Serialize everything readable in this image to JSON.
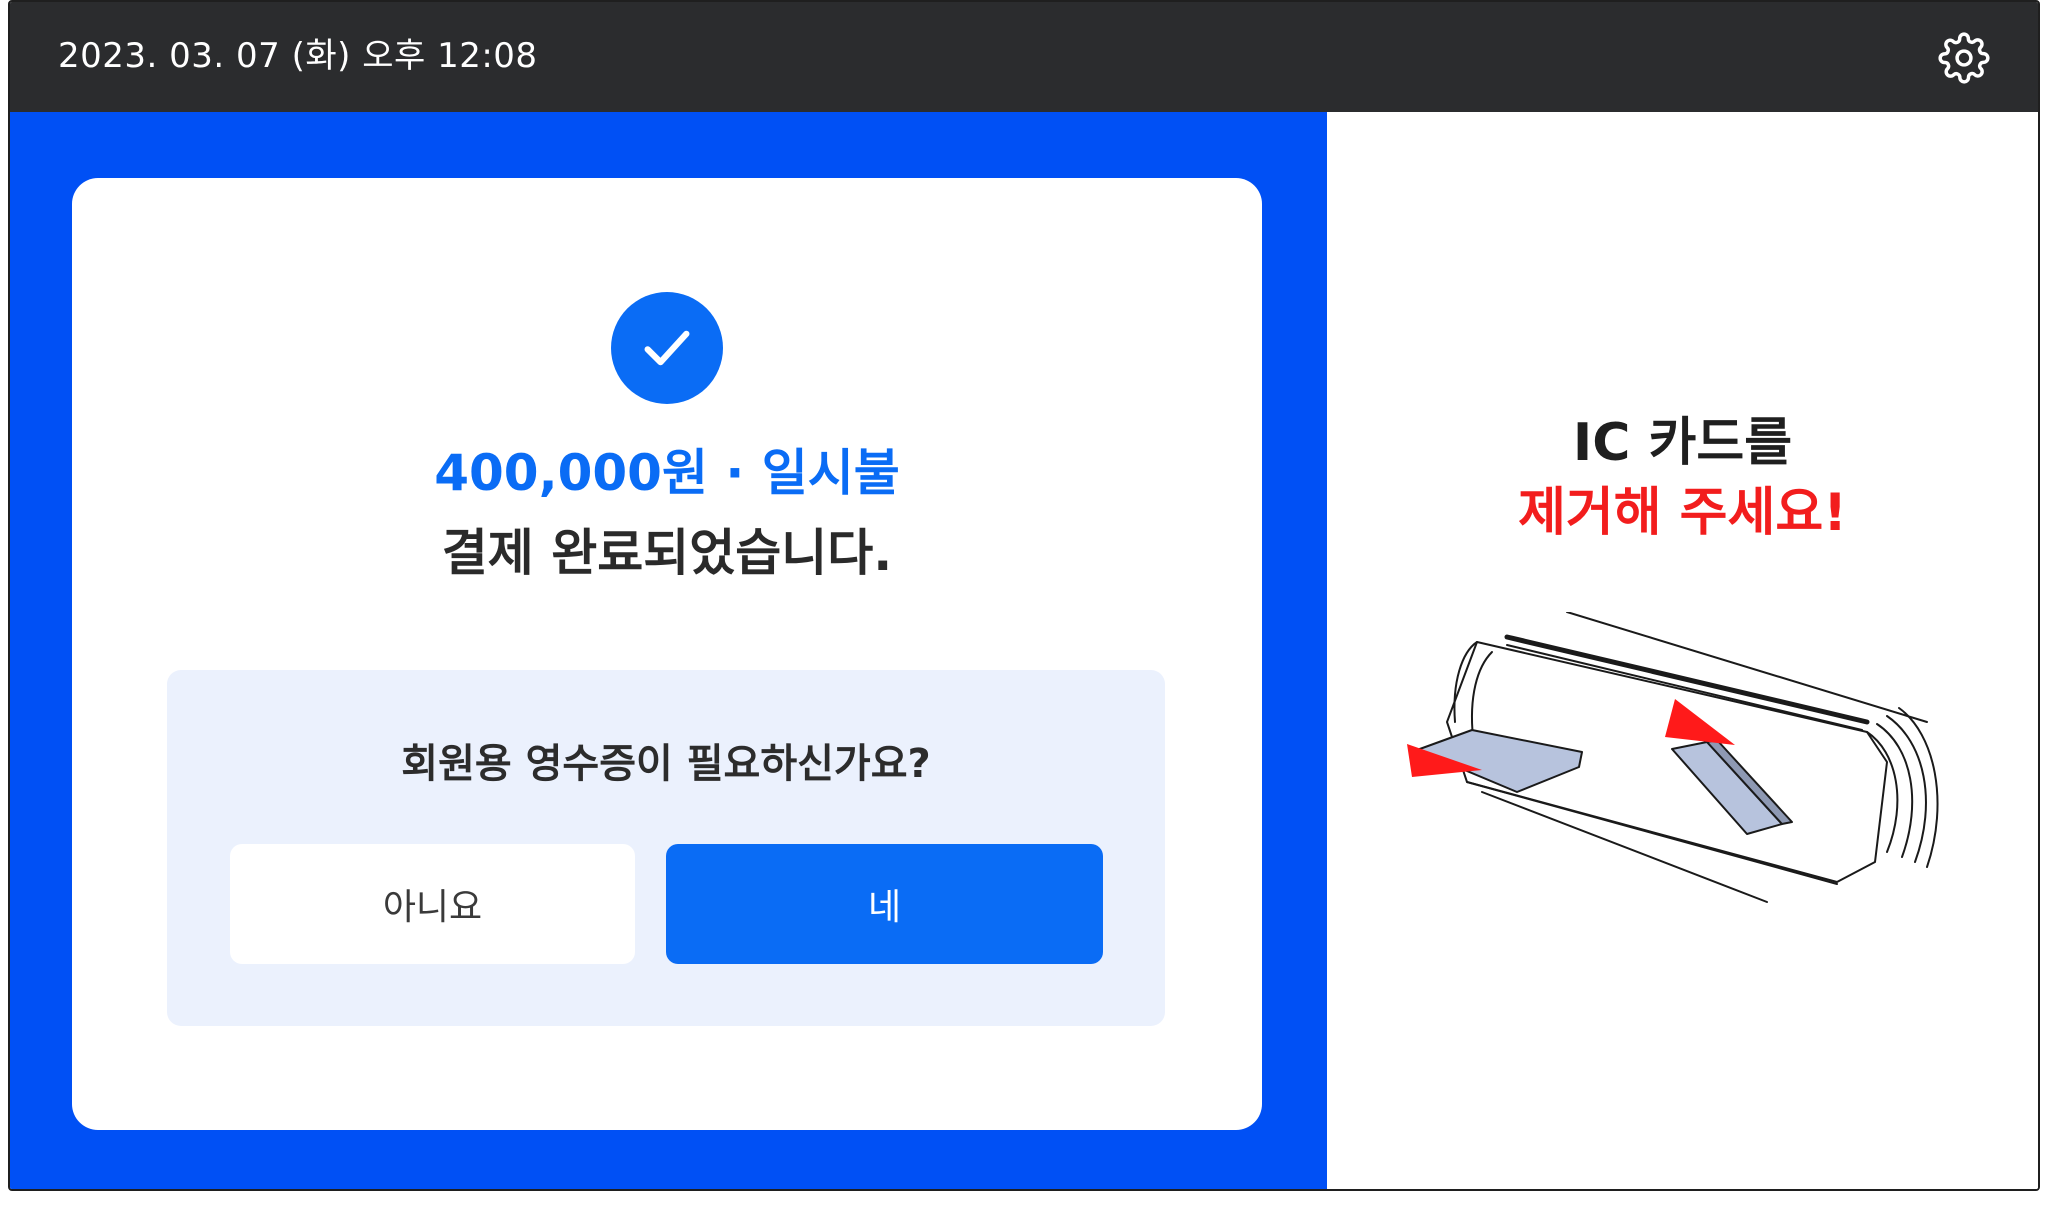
{
  "header": {
    "datetime": "2023. 03. 07 (화) 오후 12:08",
    "settings_icon": "gear-icon"
  },
  "payment": {
    "status_icon": "check-icon",
    "amount_line": "400,000원 · 일시불",
    "done_message": "결제 완료되었습니다."
  },
  "receipt": {
    "question": "회원용 영수증이 필요하신가요?",
    "no_label": "아니요",
    "yes_label": "네"
  },
  "card_reader": {
    "instruction_line1": "IC 카드를",
    "instruction_line2": "제거해 주세요!",
    "illustration_icon": "card-reader-illustration"
  },
  "colors": {
    "accent_blue": "#0a6cf5",
    "panel_blue": "#0050f5",
    "header_dark": "#2b2c2e",
    "warning_red": "#f21d1d",
    "receipt_bg": "#ebf1fd"
  }
}
